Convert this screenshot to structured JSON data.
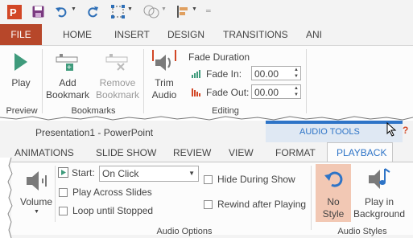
{
  "top": {
    "qat_icons": [
      "powerpoint-logo-icon",
      "save-icon",
      "undo-icon",
      "redo-icon",
      "select-icon",
      "shapes-icon",
      "arrange-icon",
      "customize-icon"
    ],
    "tabs": {
      "file": "FILE",
      "home": "HOME",
      "insert": "INSERT",
      "design": "DESIGN",
      "transitions": "TRANSITIONS",
      "animations_partial": "ANI"
    },
    "ribbon": {
      "play": "Play",
      "add_bookmark_1": "Add",
      "add_bookmark_2": "Bookmark",
      "remove_bookmark_1": "Remove",
      "remove_bookmark_2": "Bookmark",
      "trim_1": "Trim",
      "trim_2": "Audio",
      "fade_duration": "Fade Duration",
      "fade_in_label": "Fade In:",
      "fade_in_value": "00.00",
      "fade_out_label": "Fade Out:",
      "fade_out_value": "00.00",
      "group_preview": "Preview",
      "group_bookmarks": "Bookmarks",
      "group_editing": "Editing"
    }
  },
  "bottom": {
    "window_title": "Presentation1 - PowerPoint",
    "contextual_header": "AUDIO TOOLS",
    "help": "?",
    "tabs": {
      "animations_partial": "ANIMATIONS",
      "slide_show": "SLIDE SHOW",
      "review": "REVIEW",
      "view": "VIEW",
      "format": "FORMAT",
      "playback": "PLAYBACK"
    },
    "ribbon": {
      "volume": "Volume",
      "start_label": "Start:",
      "start_value": "On Click",
      "play_across_slides": "Play Across Slides",
      "loop_until_stopped": "Loop until Stopped",
      "hide_during_show": "Hide During Show",
      "rewind_after_playing": "Rewind after Playing",
      "no_style_1": "No",
      "no_style_2": "Style",
      "play_bg_1": "Play in",
      "play_bg_2": "Background",
      "group_audio_options": "Audio Options",
      "group_audio_styles": "Audio Styles"
    }
  },
  "colors": {
    "file_tab": "#b7472a",
    "accent_orange": "#d24726",
    "contextual_blue": "#2e74c7",
    "selected_style_bg": "#f2c8b4"
  }
}
